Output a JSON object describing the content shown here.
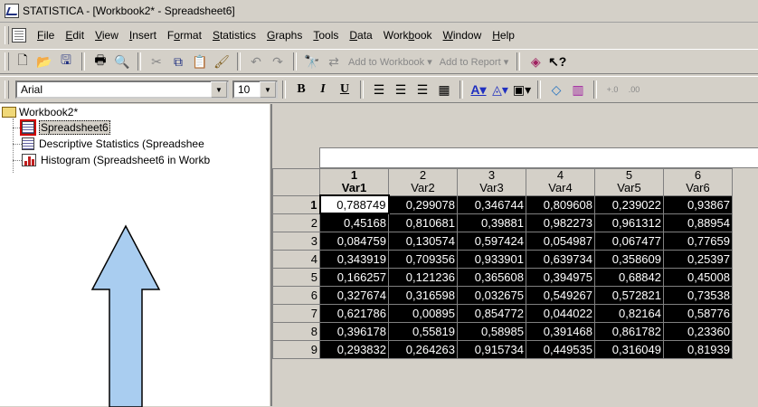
{
  "window": {
    "title": "STATISTICA - [Workbook2* - Spreadsheet6]"
  },
  "menu": [
    {
      "pre": "",
      "u": "F",
      "post": "ile"
    },
    {
      "pre": "",
      "u": "E",
      "post": "dit"
    },
    {
      "pre": "",
      "u": "V",
      "post": "iew"
    },
    {
      "pre": "",
      "u": "I",
      "post": "nsert"
    },
    {
      "pre": "F",
      "u": "o",
      "post": "rmat"
    },
    {
      "pre": "",
      "u": "S",
      "post": "tatistics"
    },
    {
      "pre": "",
      "u": "G",
      "post": "raphs"
    },
    {
      "pre": "",
      "u": "T",
      "post": "ools"
    },
    {
      "pre": "",
      "u": "D",
      "post": "ata"
    },
    {
      "pre": "Work",
      "u": "b",
      "post": "ook"
    },
    {
      "pre": "",
      "u": "W",
      "post": "indow"
    },
    {
      "pre": "",
      "u": "H",
      "post": "elp"
    }
  ],
  "toolbar": {
    "add_to_workbook": "Add to Workbook ▾",
    "add_to_report": "Add to Report ▾",
    "font_name": "Arial",
    "font_size": "10",
    "bold": "B",
    "italic": "I",
    "underline": "U"
  },
  "tree": {
    "root": "Workbook2*",
    "items": [
      {
        "label": "Spreadsheet6",
        "icon": "spreadsheet-icon",
        "selected": true
      },
      {
        "label": "Descriptive Statistics (Spreadshee",
        "icon": "spreadsheet-icon"
      },
      {
        "label": "Histogram (Spreadsheet6 in Workb",
        "icon": "histogram-icon"
      }
    ]
  },
  "grid": {
    "columns": [
      {
        "num": "1",
        "name": "Var1"
      },
      {
        "num": "2",
        "name": "Var2"
      },
      {
        "num": "3",
        "name": "Var3"
      },
      {
        "num": "4",
        "name": "Var4"
      },
      {
        "num": "5",
        "name": "Var5"
      },
      {
        "num": "6",
        "name": "Var6"
      }
    ],
    "rows": [
      {
        "n": "1",
        "cells": [
          "0,788749",
          "0,299078",
          "0,346744",
          "0,809608",
          "0,239022",
          "0,93867"
        ]
      },
      {
        "n": "2",
        "cells": [
          "0,45168",
          "0,810681",
          "0,39881",
          "0,982273",
          "0,961312",
          "0,88954"
        ]
      },
      {
        "n": "3",
        "cells": [
          "0,084759",
          "0,130574",
          "0,597424",
          "0,054987",
          "0,067477",
          "0,77659"
        ]
      },
      {
        "n": "4",
        "cells": [
          "0,343919",
          "0,709356",
          "0,933901",
          "0,639734",
          "0,358609",
          "0,25397"
        ]
      },
      {
        "n": "5",
        "cells": [
          "0,166257",
          "0,121236",
          "0,365608",
          "0,394975",
          "0,68842",
          "0,45008"
        ]
      },
      {
        "n": "6",
        "cells": [
          "0,327674",
          "0,316598",
          "0,032675",
          "0,549267",
          "0,572821",
          "0,73538"
        ]
      },
      {
        "n": "7",
        "cells": [
          "0,621786",
          "0,00895",
          "0,854772",
          "0,044022",
          "0,82164",
          "0,58776"
        ]
      },
      {
        "n": "8",
        "cells": [
          "0,396178",
          "0,55819",
          "0,58985",
          "0,391468",
          "0,861782",
          "0,23360"
        ]
      },
      {
        "n": "9",
        "cells": [
          "0,293832",
          "0,264263",
          "0,915734",
          "0,449535",
          "0,316049",
          "0,81939"
        ]
      }
    ]
  },
  "colors": {
    "annotation_arrow": "#a9cdf0",
    "selection_outline": "#d00000"
  }
}
